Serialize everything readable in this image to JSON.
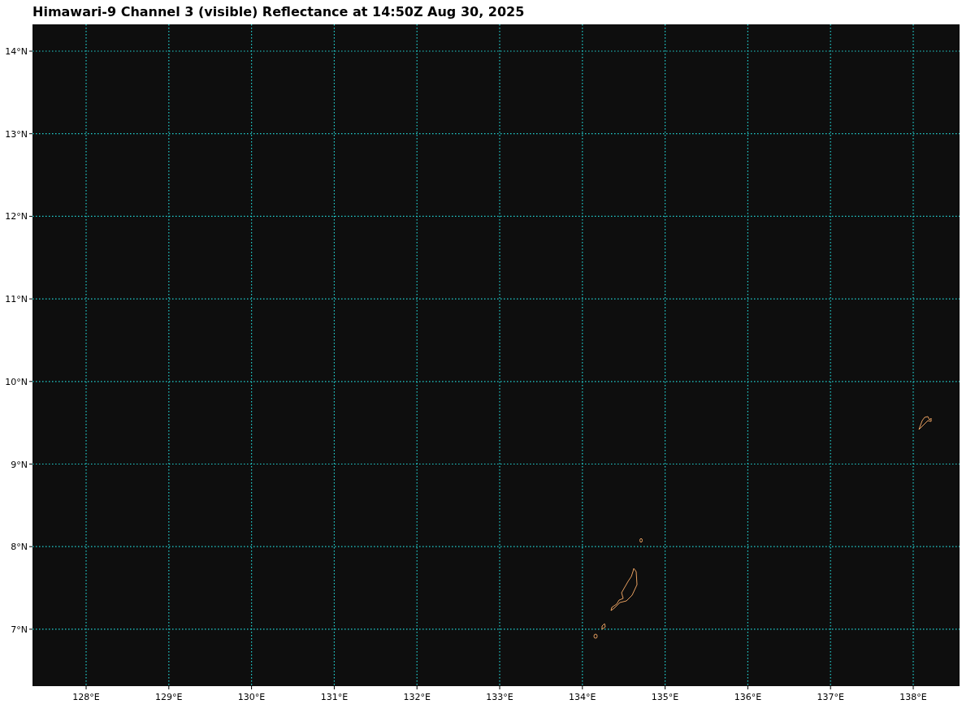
{
  "title": "Himawari-9 Channel 3 (visible) Reflectance at 14:50Z Aug 30, 2025",
  "map": {
    "lat_labels": [
      "14°N",
      "13°N",
      "12°N",
      "11°N",
      "10°N",
      "9°N",
      "8°N",
      "7°N"
    ],
    "lon_labels": [
      "128°E",
      "129°E",
      "130°E",
      "131°E",
      "132°E",
      "133°E",
      "134°E",
      "135°E",
      "136°E",
      "137°E",
      "138°E"
    ]
  }
}
